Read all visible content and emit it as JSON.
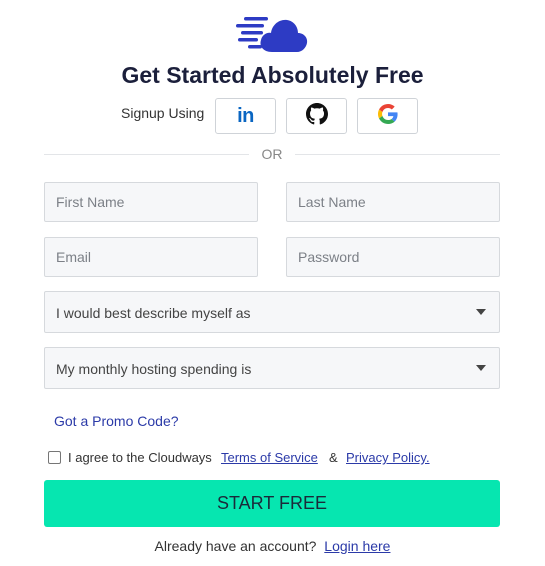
{
  "colors": {
    "brand": "#2d3bc4",
    "accent_button": "#06e6b0",
    "link": "#2b3aa8",
    "title": "#1b1f3b",
    "field_bg": "#f6f7f9"
  },
  "header": {
    "logo_icon": "cloud-speed-icon",
    "title": "Get Started Absolutely Free"
  },
  "signup": {
    "label": "Signup Using",
    "providers": [
      {
        "name": "linkedin",
        "icon": "linkedin-icon",
        "text": "in"
      },
      {
        "name": "github",
        "icon": "github-icon"
      },
      {
        "name": "google",
        "icon": "google-icon"
      }
    ]
  },
  "divider": {
    "text": "OR"
  },
  "form": {
    "first_name": {
      "placeholder": "First Name",
      "value": ""
    },
    "last_name": {
      "placeholder": "Last Name",
      "value": ""
    },
    "email": {
      "placeholder": "Email",
      "value": ""
    },
    "password": {
      "placeholder": "Password",
      "value": ""
    },
    "describe_select": {
      "selected": "I would best describe myself as"
    },
    "spending_select": {
      "selected": "My monthly hosting spending is"
    },
    "promo_link": "Got a Promo Code?",
    "agree": {
      "checked": false,
      "text": "I agree to the Cloudways",
      "terms": "Terms of Service",
      "ampersand": "&",
      "privacy": "Privacy Policy."
    },
    "submit_label": "START FREE"
  },
  "footer": {
    "prompt": "Already have an account?",
    "login_link": "Login here"
  }
}
